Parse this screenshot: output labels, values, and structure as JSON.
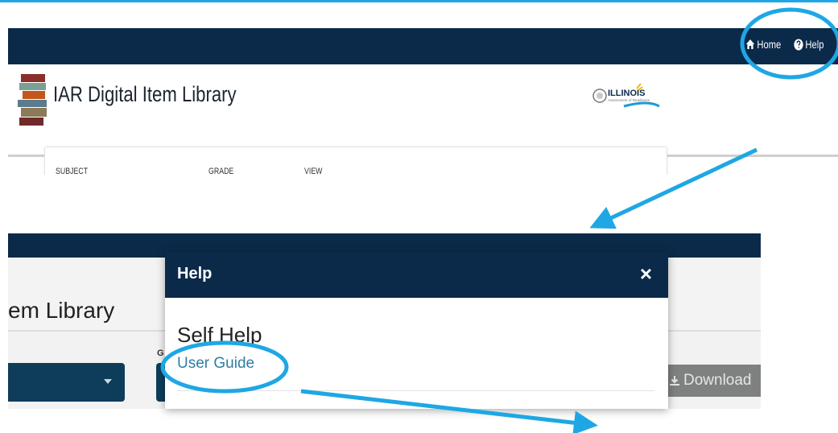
{
  "top_window": {
    "nav": {
      "home_label": "Home",
      "help_label": "Help"
    },
    "header": {
      "app_title": "IAR Digital Item Library",
      "logo_text": "ILLINOIS",
      "logo_subtext": "Assessment of Readiness"
    },
    "filters": {
      "subject_label": "SUBJECT",
      "grade_label": "GRADE",
      "view_label": "VIEW"
    }
  },
  "bottom_window": {
    "header": {
      "app_title_partial": "em Library"
    },
    "grade_label_partial": "G",
    "download_label": "Download",
    "modal": {
      "title": "Help",
      "close_symbol": "×",
      "heading": "Self Help",
      "link_label": "User Guide"
    }
  },
  "annotations": {
    "highlight_color": "#1ea7e4",
    "nav_color": "#0b2a4a",
    "link_color": "#2f7ea3"
  }
}
